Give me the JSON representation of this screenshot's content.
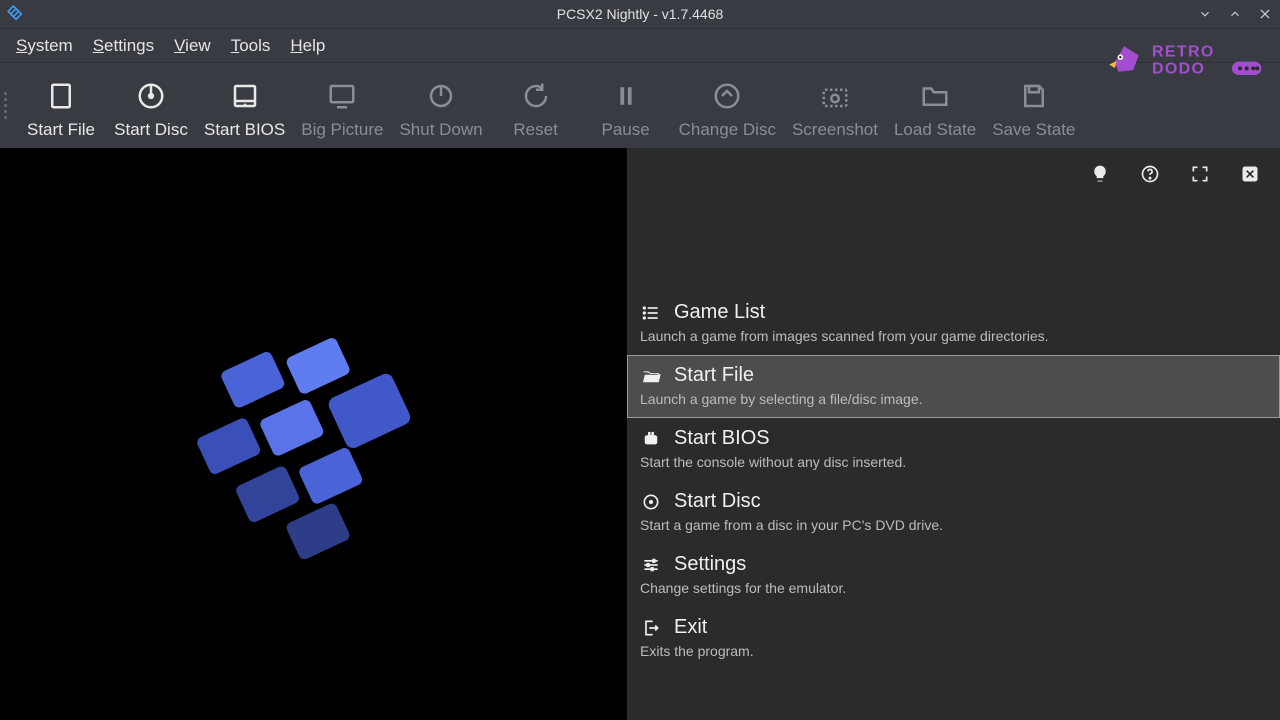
{
  "window": {
    "title": "PCSX2 Nightly - v1.7.4468"
  },
  "menubar": [
    "System",
    "Settings",
    "View",
    "Tools",
    "Help"
  ],
  "toolbar": [
    {
      "key": "start-file",
      "label": "Start File",
      "enabled": true,
      "icon": "file"
    },
    {
      "key": "start-disc",
      "label": "Start Disc",
      "enabled": true,
      "icon": "disc"
    },
    {
      "key": "start-bios",
      "label": "Start BIOS",
      "enabled": true,
      "icon": "bios"
    },
    {
      "key": "big-picture",
      "label": "Big Picture",
      "enabled": false,
      "icon": "monitor"
    },
    {
      "key": "shut-down",
      "label": "Shut Down",
      "enabled": false,
      "icon": "power"
    },
    {
      "key": "reset",
      "label": "Reset",
      "enabled": false,
      "icon": "reset"
    },
    {
      "key": "pause",
      "label": "Pause",
      "enabled": false,
      "icon": "pause"
    },
    {
      "key": "change-disc",
      "label": "Change Disc",
      "enabled": false,
      "icon": "changedisc"
    },
    {
      "key": "screenshot",
      "label": "Screenshot",
      "enabled": false,
      "icon": "camera"
    },
    {
      "key": "load-state",
      "label": "Load State",
      "enabled": false,
      "icon": "folder"
    },
    {
      "key": "save-state",
      "label": "Save State",
      "enabled": false,
      "icon": "save"
    }
  ],
  "brand": {
    "name": "RETRO DODO"
  },
  "panel_icons": [
    "hint",
    "help",
    "fullscreen",
    "close"
  ],
  "main_menu": [
    {
      "key": "game-list",
      "title": "Game List",
      "desc": "Launch a game from images scanned from your game directories.",
      "icon": "list",
      "selected": false
    },
    {
      "key": "start-file",
      "title": "Start File",
      "desc": "Launch a game by selecting a file/disc image.",
      "icon": "folderopen",
      "selected": true
    },
    {
      "key": "start-bios",
      "title": "Start BIOS",
      "desc": "Start the console without any disc inserted.",
      "icon": "chip",
      "selected": false
    },
    {
      "key": "start-disc",
      "title": "Start Disc",
      "desc": "Start a game from a disc in your PC's DVD drive.",
      "icon": "discsmall",
      "selected": false
    },
    {
      "key": "settings",
      "title": "Settings",
      "desc": "Change settings for the emulator.",
      "icon": "sliders",
      "selected": false
    },
    {
      "key": "exit",
      "title": "Exit",
      "desc": "Exits the program.",
      "icon": "exit",
      "selected": false
    }
  ]
}
